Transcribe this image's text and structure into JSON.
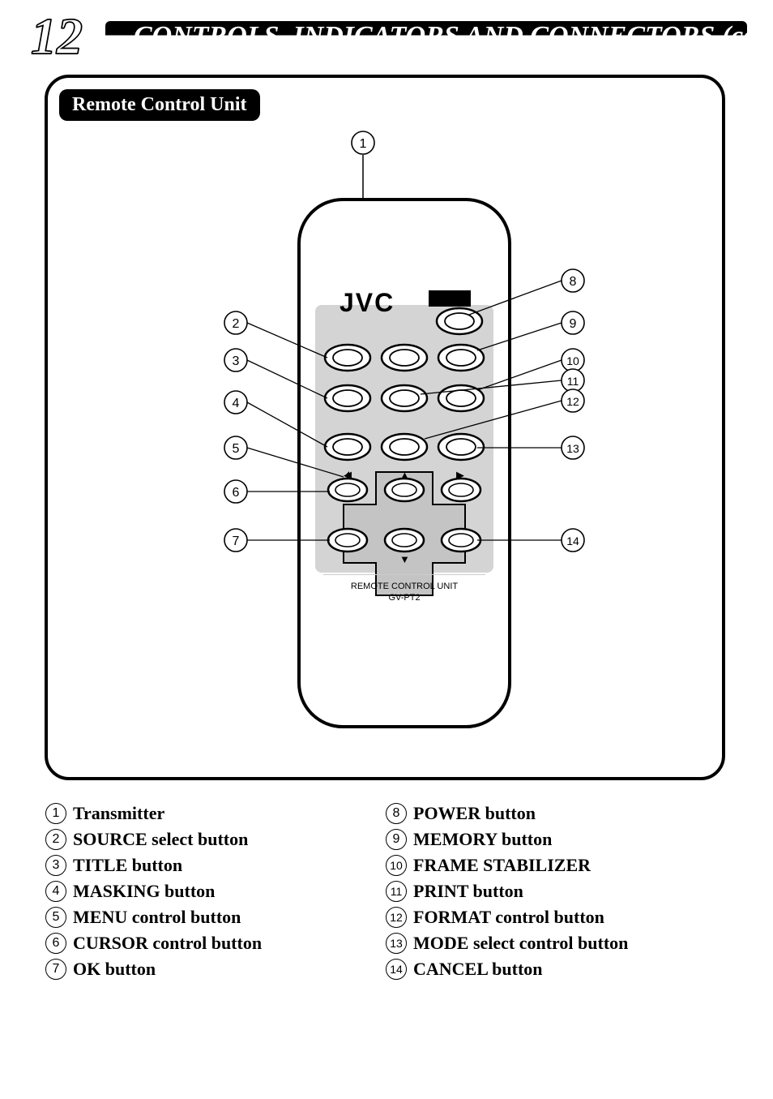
{
  "page_number": "12",
  "header": "CONTROLS, INDICATORS AND CONNECTORS (cont.)",
  "section_label": "Remote Control Unit",
  "brand": "JVC",
  "remote_label_1": "REMOTE CONTROL UNIT",
  "remote_label_2": "GV-PT2",
  "callouts": {
    "1": "1",
    "2": "2",
    "3": "3",
    "4": "4",
    "5": "5",
    "6": "6",
    "7": "7",
    "8": "8",
    "9": "9",
    "10": "10",
    "11": "11",
    "12": "12",
    "13": "13",
    "14": "14"
  },
  "legend_left": [
    {
      "n": "1",
      "t": "Transmitter"
    },
    {
      "n": "2",
      "t": "SOURCE select button"
    },
    {
      "n": "3",
      "t": "TITLE button"
    },
    {
      "n": "4",
      "t": "MASKING button"
    },
    {
      "n": "5",
      "t": "MENU control button"
    },
    {
      "n": "6",
      "t": "CURSOR control button"
    },
    {
      "n": "7",
      "t": "OK button"
    }
  ],
  "legend_right": [
    {
      "n": "8",
      "t": "POWER button"
    },
    {
      "n": "9",
      "t": "MEMORY button"
    },
    {
      "n": "10",
      "t": "FRAME STABILIZER"
    },
    {
      "n": "11",
      "t": "PRINT button"
    },
    {
      "n": "12",
      "t": "FORMAT control button"
    },
    {
      "n": "13",
      "t": "MODE select control button"
    },
    {
      "n": "14",
      "t": "CANCEL button"
    }
  ]
}
